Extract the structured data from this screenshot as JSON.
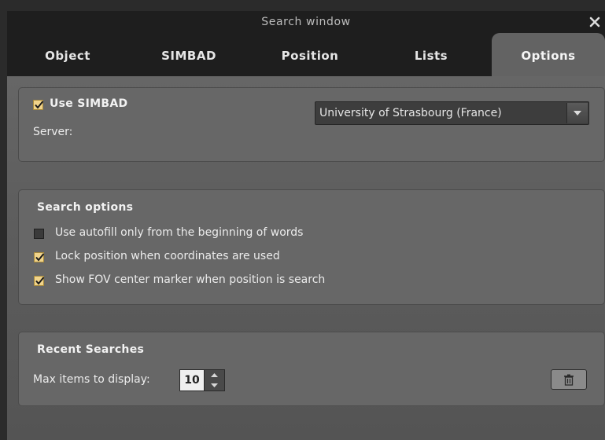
{
  "window": {
    "title": "Search window",
    "close_icon": "close-icon"
  },
  "tabs": [
    {
      "label": "Object"
    },
    {
      "label": "SIMBAD"
    },
    {
      "label": "Position"
    },
    {
      "label": "Lists"
    },
    {
      "label": "Options",
      "active": true
    }
  ],
  "simbad_panel": {
    "use_simbad_label": "Use SIMBAD",
    "use_simbad_checked": true,
    "server_label": "Server:",
    "server_value": "University of Strasbourg (France)"
  },
  "search_options": {
    "heading": "Search options",
    "items": [
      {
        "label": "Use autofill only from the beginning of words",
        "checked": false
      },
      {
        "label": "Lock position when coordinates are used",
        "checked": true
      },
      {
        "label": "Show FOV center marker when position is search",
        "checked": true
      }
    ]
  },
  "recent_searches": {
    "heading": "Recent Searches",
    "max_items_label": "Max items to display:",
    "max_items_value": "10",
    "clear_icon": "trash-icon"
  },
  "colors": {
    "accent_checkbox": "#f1d48a",
    "titlebar": "#1e1e1e",
    "panel": "#676767"
  }
}
